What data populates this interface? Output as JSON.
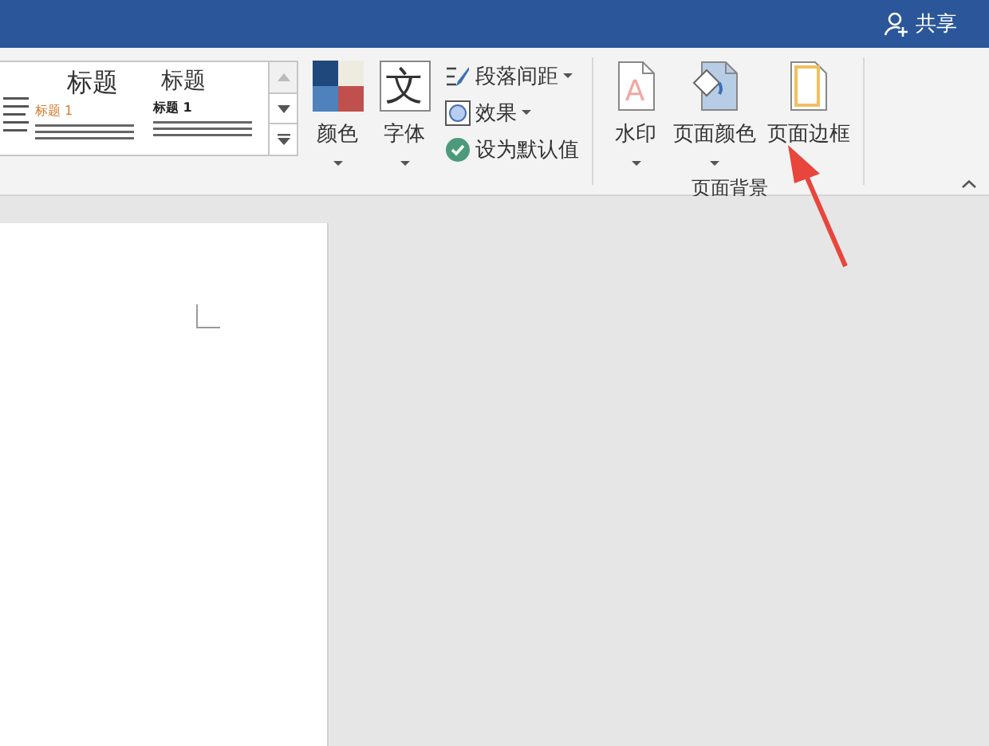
{
  "title_bar": {
    "share_button": "共享"
  },
  "style_gallery": {
    "styles": [
      {
        "title": "标题",
        "heading": "标题 1",
        "kind": "accent"
      },
      {
        "title": "标题",
        "heading": "标题 1",
        "kind": "plain"
      }
    ]
  },
  "design_group": {
    "big_buttons": [
      {
        "label": "颜色",
        "kind": "colors",
        "has_dropdown": true
      },
      {
        "label": "字体",
        "kind": "fonts",
        "glyph": "文",
        "has_dropdown": true
      }
    ],
    "small_buttons": [
      {
        "label": "段落间距",
        "kind": "spacing",
        "has_dropdown": true
      },
      {
        "label": "效果",
        "kind": "effects",
        "has_dropdown": true
      },
      {
        "label": "设为默认值",
        "kind": "default",
        "has_dropdown": false
      }
    ]
  },
  "page_background_group": {
    "label": "页面背景",
    "buttons": [
      {
        "label": "水印",
        "kind": "watermark",
        "glyph": "A",
        "has_dropdown": true
      },
      {
        "label": "页面颜色",
        "kind": "page_color",
        "has_dropdown": true
      },
      {
        "label": "页面边框",
        "kind": "page_border",
        "has_dropdown": false
      }
    ]
  }
}
